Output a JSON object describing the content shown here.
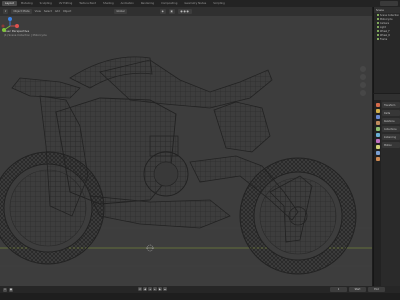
{
  "menu": {
    "workspaces": [
      "Layout",
      "Modeling",
      "Sculpting",
      "UV Editing",
      "Texture Paint",
      "Shading",
      "Animation",
      "Rendering",
      "Compositing",
      "Geometry Nodes",
      "Scripting"
    ],
    "active_workspace": "Layout"
  },
  "viewport": {
    "mode_label": "Object Mode",
    "view_label": "View",
    "select_label": "Select",
    "add_label": "Add",
    "object_label": "Object",
    "global_label": "Global",
    "overlay_title": "User Perspective",
    "overlay_subtitle": "(1) Scene Collection | Motorcycle"
  },
  "outliner": {
    "title": "Scene",
    "rows": [
      "Scene Collection",
      "Motorcycle",
      "Camera",
      "Light",
      "Wheel_F",
      "Wheel_R",
      "Frame"
    ]
  },
  "properties": {
    "panels": [
      "Transform",
      "Delta",
      "Relations",
      "Collections",
      "Instancing",
      "Motion"
    ],
    "tab_colors": [
      "#d46a4a",
      "#d2b04a",
      "#6a8ad4",
      "#c08c5e",
      "#8ec070",
      "#6ab0d4",
      "#c070c0",
      "#d4d47a",
      "#7aa0d4",
      "#cf8a52"
    ]
  },
  "timeline": {
    "start_label": "Start",
    "end_label": "End",
    "current_frame": "1"
  },
  "colors": {
    "accent": "#4772b3",
    "wire": "#1a1a1a",
    "floor_line": "#8aa03c"
  }
}
